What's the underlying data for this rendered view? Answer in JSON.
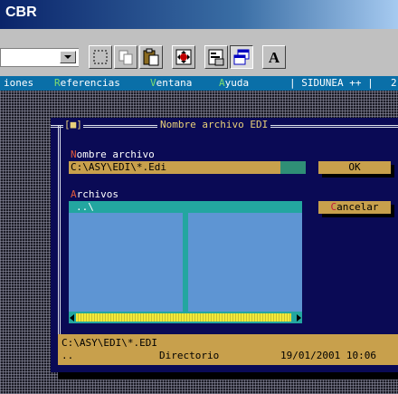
{
  "window": {
    "title": "CBR"
  },
  "toolbar": {
    "combo_value": "",
    "buttons": [
      {
        "name": "select-rect-icon"
      },
      {
        "name": "copy-icon"
      },
      {
        "name": "paste-clipboard-icon"
      },
      {
        "name": "move-arrows-icon"
      },
      {
        "name": "properties-icon"
      },
      {
        "name": "window-restore-icon"
      },
      {
        "name": "font-a-icon",
        "label": "A"
      }
    ]
  },
  "menubar": {
    "items": [
      {
        "label": "iones"
      },
      {
        "hot": "R",
        "rest": "eferencias"
      },
      {
        "hot": "V",
        "rest": "entana"
      },
      {
        "hot": "A",
        "rest": "yuda"
      },
      {
        "label": "| SIDUNEA ++ |"
      },
      {
        "label": "2"
      }
    ]
  },
  "dialog": {
    "close_box": "[■]",
    "title": "Nombre archivo EDI",
    "filename_label": {
      "hot": "N",
      "rest": "ombre archivo"
    },
    "filename_value": "C:\\ASY\\EDI\\*.Edi",
    "files_label": {
      "hot": "A",
      "rest": "rchivos"
    },
    "files": [
      ".."
    ],
    "files_selected_display": "..\\",
    "ok": {
      "hot": "",
      "rest": "OK"
    },
    "cancel": {
      "hot": "C",
      "rest": "ancelar"
    },
    "info": {
      "path": "C:\\ASY\\EDI\\*.EDI",
      "entry": "..",
      "type": "Directorio",
      "datetime": "19/01/2001 10:06"
    },
    "colors": {
      "field": "#c8a04c",
      "list": "#5e95d3",
      "selection": "#23a6a0",
      "background": "#0a0a55",
      "hotkey": "#e05a3c"
    }
  }
}
